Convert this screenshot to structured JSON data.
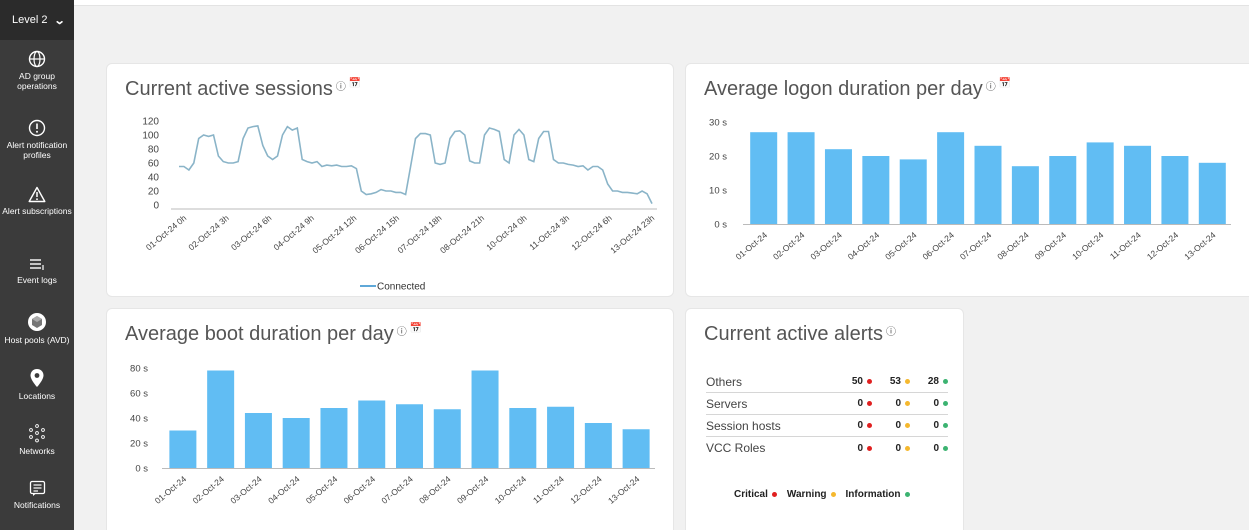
{
  "sidebar": {
    "level_label": "Level 2",
    "items": [
      {
        "label": "AD group operations",
        "icon": "globe-icon"
      },
      {
        "label": "Alert notification profiles",
        "icon": "alert-circle-icon"
      },
      {
        "label": "Alert subscriptions",
        "icon": "warning-triangle-icon"
      },
      {
        "label": "Event logs",
        "icon": "list-icon"
      },
      {
        "label": "Host pools (AVD)",
        "icon": "host-pool-icon"
      },
      {
        "label": "Locations",
        "icon": "location-pin-icon"
      },
      {
        "label": "Networks",
        "icon": "network-icon"
      },
      {
        "label": "Notifications",
        "icon": "notification-icon"
      }
    ]
  },
  "cards": {
    "sessions": {
      "title": "Current active sessions",
      "legend": "Connected"
    },
    "logon": {
      "title": "Average logon duration per day"
    },
    "boot": {
      "title": "Average boot duration per day"
    },
    "alerts": {
      "title": "Current active alerts"
    }
  },
  "alerts_table": {
    "rows": [
      {
        "name": "Others",
        "critical": "50",
        "warning": "53",
        "information": "28"
      },
      {
        "name": "Servers",
        "critical": "0",
        "warning": "0",
        "information": "0"
      },
      {
        "name": "Session hosts",
        "critical": "0",
        "warning": "0",
        "information": "0"
      },
      {
        "name": "VCC Roles",
        "critical": "0",
        "warning": "0",
        "information": "0"
      }
    ],
    "legend": {
      "critical": "Critical",
      "warning": "Warning",
      "information": "Information"
    }
  },
  "colors": {
    "critical": "#e02020",
    "warning": "#f5b82e",
    "information": "#3cb371",
    "bar": "#61bdf3",
    "line": "#8ab4c8",
    "sidebar": "#3b3b3b"
  },
  "chart_data": [
    {
      "type": "line",
      "title": "Current active sessions",
      "ylim": [
        0,
        120
      ],
      "yticks": [
        "120",
        "100",
        "80",
        "60",
        "40",
        "20",
        "0"
      ],
      "x_tick_labels": [
        "01-Oct-24 0h",
        "02-Oct-24 3h",
        "03-Oct-24 6h",
        "04-Oct-24 9h",
        "05-Oct-24 12h",
        "06-Oct-24 15h",
        "07-Oct-24 18h",
        "08-Oct-24 21h",
        "10-Oct-24 0h",
        "11-Oct-24 3h",
        "12-Oct-24 6h",
        "13-Oct-24 23h"
      ],
      "series": [
        {
          "name": "Connected",
          "values": [
            55,
            55,
            50,
            60,
            95,
            100,
            98,
            100,
            70,
            62,
            60,
            60,
            62,
            95,
            110,
            112,
            113,
            85,
            70,
            65,
            70,
            100,
            112,
            107,
            110,
            65,
            62,
            60,
            62,
            55,
            57,
            56,
            57,
            55,
            55,
            56,
            52,
            20,
            15,
            16,
            18,
            22,
            20,
            20,
            18,
            18,
            15,
            55,
            95,
            102,
            102,
            100,
            60,
            58,
            60,
            95,
            105,
            106,
            100,
            63,
            60,
            60,
            100,
            110,
            108,
            105,
            65,
            60,
            100,
            108,
            100,
            65,
            62,
            95,
            105,
            105,
            65,
            60,
            60,
            58,
            57,
            55,
            56,
            50,
            55,
            55,
            50,
            30,
            20,
            20,
            18,
            18,
            17,
            16,
            20,
            16,
            2
          ]
        }
      ],
      "grid": false,
      "legend": "bottom"
    },
    {
      "type": "bar",
      "title": "Average logon duration per day",
      "categories": [
        "01-Oct-24",
        "02-Oct-24",
        "03-Oct-24",
        "04-Oct-24",
        "05-Oct-24",
        "06-Oct-24",
        "07-Oct-24",
        "08-Oct-24",
        "09-Oct-24",
        "10-Oct-24",
        "11-Oct-24",
        "12-Oct-24",
        "13-Oct-24"
      ],
      "values": [
        27,
        27,
        22,
        20,
        19,
        27,
        23,
        17,
        20,
        24,
        23,
        20,
        18
      ],
      "ylim": [
        0,
        30
      ],
      "yticks": [
        "30 s",
        "20 s",
        "10 s",
        "0 s"
      ],
      "grid": false
    },
    {
      "type": "bar",
      "title": "Average boot duration per day",
      "categories": [
        "01-Oct-24",
        "02-Oct-24",
        "03-Oct-24",
        "04-Oct-24",
        "05-Oct-24",
        "06-Oct-24",
        "07-Oct-24",
        "08-Oct-24",
        "09-Oct-24",
        "10-Oct-24",
        "11-Oct-24",
        "12-Oct-24",
        "13-Oct-24"
      ],
      "values": [
        30,
        78,
        44,
        40,
        48,
        54,
        51,
        47,
        78,
        48,
        49,
        36,
        31
      ],
      "ylim": [
        0,
        80
      ],
      "yticks": [
        "80 s",
        "60 s",
        "40 s",
        "20 s",
        "0 s"
      ],
      "grid": false
    }
  ]
}
